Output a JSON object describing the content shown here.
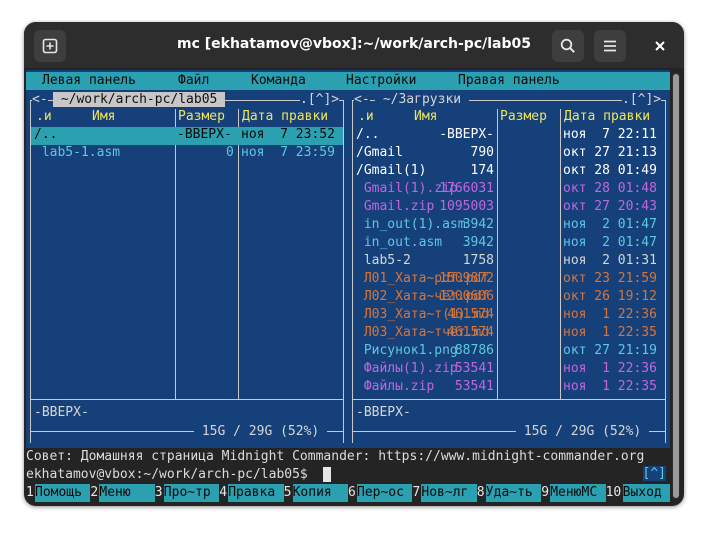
{
  "window": {
    "title": "mc [ekhatamov@vbox]:~/work/arch-pc/lab05"
  },
  "icons": {
    "new_tab": "plus-in-box-icon",
    "search": "search-icon",
    "menu": "hamburger-icon",
    "close": "close-icon"
  },
  "colors": {
    "panel_bg": "#16407a",
    "bar_cyan": "#2aa0b0",
    "header_yellow": "#f0e45a",
    "dir_white": "#ffffff",
    "file_cyan": "#5ec8e0",
    "archive_magenta": "#c266e0",
    "doc_orange": "#d6753a"
  },
  "menubar": [
    "Левая панель",
    "Файл",
    "Команда",
    "Настройки",
    "Правая панель"
  ],
  "left": {
    "path": " ~/work/arch-pc/lab05 ",
    "corner": ".[^]>",
    "arrow": "<-",
    "headers": {
      "name_key": ".и",
      "name": "Имя",
      "size": "Размер",
      "date": "Дата правки"
    },
    "rows": [
      {
        "name": "/..",
        "size": "-ВВЕРХ-",
        "date": "ноя  7 23:52",
        "type": "dir",
        "selected": true
      },
      {
        "name": " lab5-1.asm",
        "size": "0",
        "date": "ноя  7 23:59",
        "type": "file",
        "selected": false
      }
    ],
    "mini": "-ВВЕРХ-",
    "disk": " 15G / 29G (52%) "
  },
  "right": {
    "path": " ~/Загрузки ",
    "corner": ".[^]>",
    "arrow": "<-",
    "headers": {
      "name_key": ".и",
      "name": "Имя",
      "size": "Размер",
      "date": "Дата правки"
    },
    "rows": [
      {
        "name": "/..",
        "size": "-ВВЕРХ-",
        "date": "ноя  7 22:11",
        "type": "dir"
      },
      {
        "name": "/Gmail",
        "size": "790",
        "date": "окт 27 21:13",
        "type": "dir"
      },
      {
        "name": "/Gmail(1)",
        "size": "174",
        "date": "окт 28 01:49",
        "type": "dir"
      },
      {
        "name": " Gmail(1).zip",
        "size": "1766031",
        "date": "окт 28 01:48",
        "type": "archive"
      },
      {
        "name": " Gmail.zip",
        "size": "1095003",
        "date": "окт 27 20:43",
        "type": "archive"
      },
      {
        "name": " in_out(1).asm",
        "size": "3942",
        "date": "ноя  2 01:47",
        "type": "file"
      },
      {
        "name": " in_out.asm",
        "size": "3942",
        "date": "ноя  2 01:47",
        "type": "file"
      },
      {
        "name": " lab5-2",
        "size": "1758",
        "date": "ноя  2 01:31",
        "type": "plain"
      },
      {
        "name": " Л01_Хата~pdf.pdf",
        "size": "1509872",
        "date": "окт 23 21:59",
        "type": "doc"
      },
      {
        "name": " Л02_Хата~чёт.pdf",
        "size": "1200606",
        "date": "окт 26 19:12",
        "type": "doc"
      },
      {
        "name": " Л03_Хата~т(1).md",
        "size": "461574",
        "date": "ноя  1 22:36",
        "type": "doc"
      },
      {
        "name": " Л03_Хата~тчёт.md",
        "size": "461574",
        "date": "ноя  1 22:35",
        "type": "doc"
      },
      {
        "name": " Рисунок1.png",
        "size": "88786",
        "date": "окт 27 21:19",
        "type": "image"
      },
      {
        "name": " Файлы(1).zip",
        "size": "53541",
        "date": "ноя  1 22:36",
        "type": "archive"
      },
      {
        "name": " Файлы.zip",
        "size": "53541",
        "date": "ноя  1 22:35",
        "type": "archive"
      }
    ],
    "mini": "-ВВЕРХ-",
    "disk": " 15G / 29G (52%) "
  },
  "hint": "Совет: Домашняя страница Midnight Commander: https://www.midnight-commander.org",
  "prompt": "ekhatamov@vbox:~/work/arch-pc/lab05$ ",
  "prompt_right": "[^]",
  "fkeys": [
    {
      "n": "1",
      "label": "Помощь"
    },
    {
      "n": "2",
      "label": "Меню"
    },
    {
      "n": "3",
      "label": "Про~тр"
    },
    {
      "n": "4",
      "label": "Правка"
    },
    {
      "n": "5",
      "label": "Копия"
    },
    {
      "n": "6",
      "label": "Пер~ос"
    },
    {
      "n": "7",
      "label": "Нов~лг"
    },
    {
      "n": "8",
      "label": "Уда~ть"
    },
    {
      "n": "9",
      "label": "МенюМС"
    },
    {
      "n": "10",
      "label": "Выход"
    }
  ]
}
